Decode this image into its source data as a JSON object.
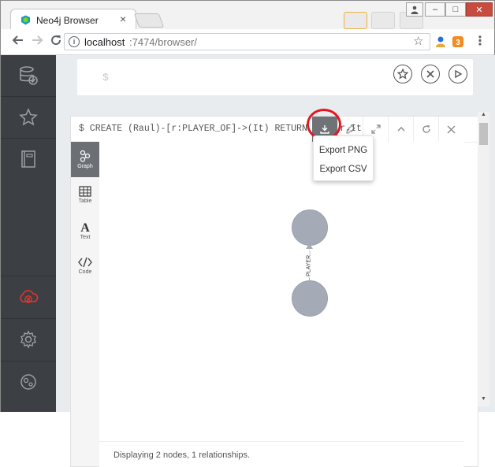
{
  "browser": {
    "tab_title": "Neo4j Browser",
    "tab_close": "×",
    "url_host": "localhost",
    "url_path": ":7474/browser/",
    "window_controls": {
      "minimize": "–",
      "maximize": "□",
      "close": "✕"
    }
  },
  "editor": {
    "prompt": "$"
  },
  "frame": {
    "query": "$ CREATE (Raul)-[r:PLAYER_OF]->(It) RETURN Raul,r,It",
    "tabs": [
      {
        "label": "Graph",
        "icon": "graph-icon"
      },
      {
        "label": "Table",
        "icon": "table-icon"
      },
      {
        "label": "Text",
        "icon": "text-icon"
      },
      {
        "label": "Code",
        "icon": "code-icon"
      }
    ],
    "relationship_label": "PLAYER...",
    "status": "Displaying 2 nodes, 1 relationships."
  },
  "export_menu": {
    "items": [
      "Export PNG",
      "Export CSV"
    ]
  },
  "colors": {
    "sidebar": "#3c3f44",
    "node": "#a5abb6",
    "highlight": "#e3171f",
    "active_tab": "#6c7075"
  }
}
